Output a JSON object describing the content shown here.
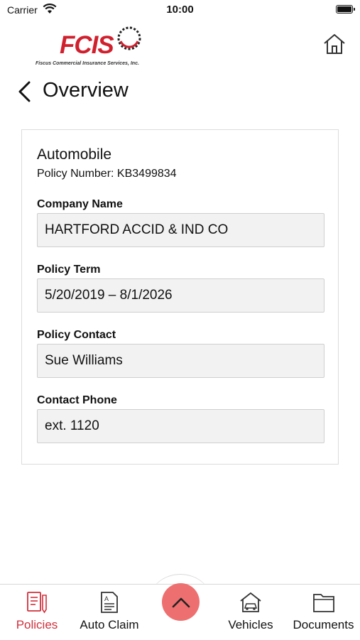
{
  "status_bar": {
    "carrier": "Carrier",
    "time": "10:00"
  },
  "header": {
    "logo_text": "FCIS",
    "logo_tagline": "Fiscus Commercial Insurance Services, Inc.",
    "page_title": "Overview"
  },
  "policy": {
    "type": "Automobile",
    "number_line": "Policy Number: KB3499834",
    "fields": [
      {
        "label": "Company Name",
        "value": "HARTFORD ACCID & IND CO"
      },
      {
        "label": "Policy Term",
        "value": "5/20/2019 – 8/1/2026"
      },
      {
        "label": "Policy Contact",
        "value": "Sue Williams"
      },
      {
        "label": "Contact Phone",
        "value": "ext. 1120"
      }
    ]
  },
  "tabbar": {
    "tabs": [
      {
        "label": "Policies",
        "icon": "policies-icon",
        "active": true
      },
      {
        "label": "Auto Claim",
        "icon": "auto-claim-icon",
        "active": false
      },
      {
        "label": "Vehicles",
        "icon": "vehicles-icon",
        "active": false
      },
      {
        "label": "Documents",
        "icon": "documents-icon",
        "active": false
      }
    ],
    "center_button_icon": "chevron-up-icon"
  },
  "colors": {
    "brand_red": "#d0202e",
    "active_tab": "#d0303c",
    "center_button": "#ee6f6f"
  }
}
